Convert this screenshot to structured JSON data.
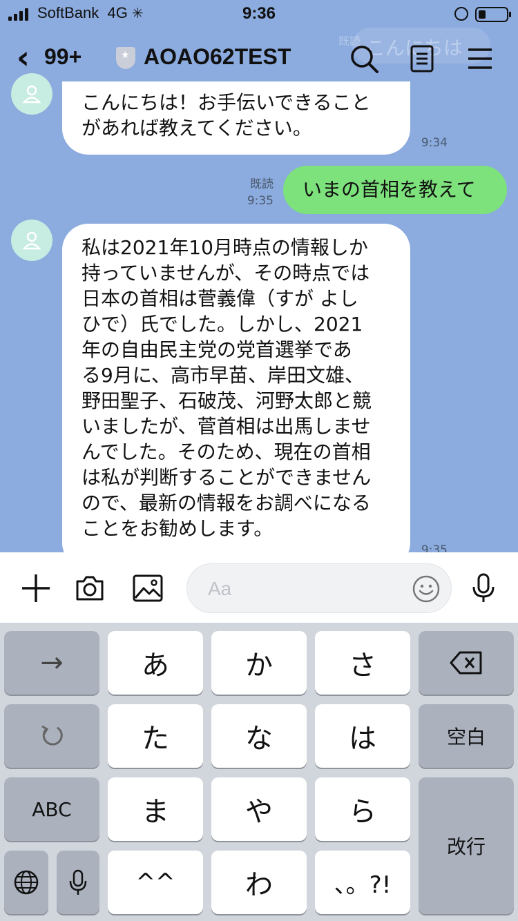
{
  "status_bar": {
    "carrier": "SoftBank",
    "network": "4G",
    "time": "9:36"
  },
  "header": {
    "back_count": "99+",
    "title": "AOAO62TEST"
  },
  "ghost": {
    "text": "こんにちは",
    "small": "既読"
  },
  "messages": [
    {
      "sender": "bot",
      "lines": [
        "こんにちは！お手伝いできること",
        "があれば教えてください。"
      ],
      "time": "9:34"
    },
    {
      "sender": "me",
      "text": "いまの首相を教えて",
      "read": "既読",
      "time": "9:35"
    },
    {
      "sender": "bot",
      "lines": [
        "私は2021年10月時点の情報しか",
        "持っていませんが、その時点では",
        "日本の首相は菅義偉（すが よし",
        "ひで）氏でした。しかし、2021",
        "年の自由民主党の党首選挙であ",
        "る9月に、高市早苗、岸田文雄、",
        "野田聖子、石破茂、河野太郎と競",
        "いましたが、菅首相は出馬しませ",
        "んでした。そのため、現在の首相",
        "は私が判断することができません",
        "ので、最新の情報をお調べになる",
        "ことをお勧めします。"
      ],
      "time": "9:35"
    }
  ],
  "input": {
    "placeholder": "Aa"
  },
  "keyboard": {
    "row1": [
      "→",
      "あ",
      "か",
      "さ",
      "⌫"
    ],
    "row2": [
      "↺",
      "た",
      "な",
      "は",
      "空白"
    ],
    "row3": [
      "ABC",
      "ま",
      "や",
      "ら",
      "改行"
    ],
    "row4": [
      "🌐",
      "🎤",
      "^^",
      "わ",
      "、。?!"
    ]
  },
  "colors": {
    "chat_bg": "#8cabde",
    "my_bubble": "#7de17c",
    "bot_avatar": "#c7ece1",
    "keyboard_bg": "#d1d5dc"
  }
}
